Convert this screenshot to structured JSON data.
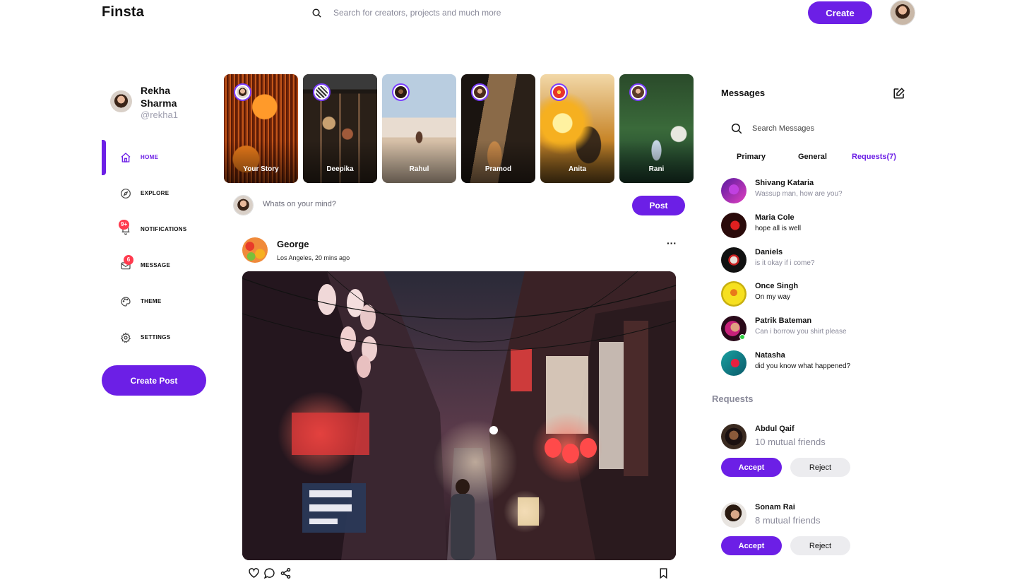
{
  "app": {
    "logo": "Finsta"
  },
  "header": {
    "search_placeholder": "Search for creators, projects and much more",
    "create_label": "Create"
  },
  "profile": {
    "name": "Rekha Sharma",
    "handle": "@rekha1"
  },
  "nav": {
    "items": [
      {
        "label": "HOME",
        "icon": "home-icon",
        "active": true
      },
      {
        "label": "EXPLORE",
        "icon": "compass-icon"
      },
      {
        "label": "NOTIFICATIONS",
        "icon": "bell-icon",
        "badge": "9+"
      },
      {
        "label": "MESSAGE",
        "icon": "mail-icon",
        "badge": "6"
      },
      {
        "label": "THEME",
        "icon": "palette-icon"
      },
      {
        "label": "SETTINGS",
        "icon": "gear-icon"
      }
    ],
    "create_post_label": "Create Post"
  },
  "stories": [
    {
      "name": "Your Story"
    },
    {
      "name": "Deepika"
    },
    {
      "name": "Rahul"
    },
    {
      "name": "Pramod"
    },
    {
      "name": "Anita"
    },
    {
      "name": "Rani"
    }
  ],
  "composer": {
    "placeholder": "Whats on your mind?",
    "post_label": "Post"
  },
  "post": {
    "author": "George",
    "meta": "Los Angeles, 20 mins ago",
    "more_label": "···"
  },
  "messages": {
    "title": "Messages",
    "search_placeholder": "Search Messages",
    "tabs": [
      {
        "label": "Primary"
      },
      {
        "label": "General"
      },
      {
        "label": "Requests(7)",
        "active": true
      }
    ],
    "list": [
      {
        "name": "Shivang Kataria",
        "text": "Wassup man, how are you?"
      },
      {
        "name": "Maria Cole",
        "text": "hope all is well"
      },
      {
        "name": "Daniels",
        "text": "is it okay if i come?"
      },
      {
        "name": "Once Singh",
        "text": "On my way"
      },
      {
        "name": "Patrik Bateman",
        "text": "Can i borrow you shirt please"
      },
      {
        "name": "Natasha",
        "text": "did you know what happened?"
      }
    ]
  },
  "requests": {
    "title": "Requests",
    "accept_label": "Accept",
    "reject_label": "Reject",
    "items": [
      {
        "name": "Abdul Qaif",
        "mutual": "10 mutual friends"
      },
      {
        "name": "Sonam Rai",
        "mutual": "8 mutual friends"
      }
    ]
  },
  "colors": {
    "accent": "#6c1fe6",
    "badge": "#ff3b4e",
    "muted": "#8a8a9a"
  }
}
